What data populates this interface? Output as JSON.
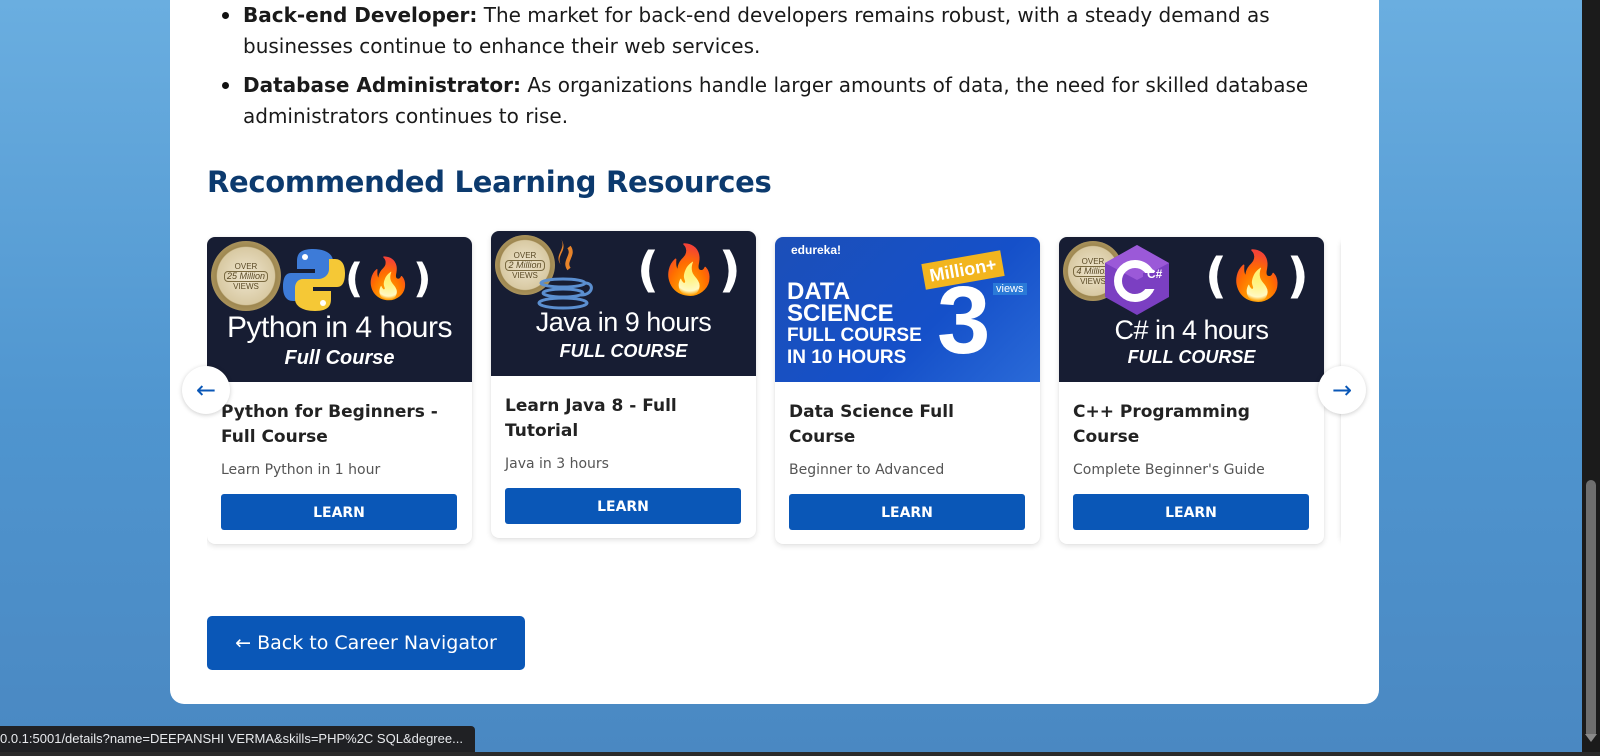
{
  "bullets": [
    {
      "title": "Back-end Developer:",
      "text": " The market for back-end developers remains robust, with a steady demand as businesses continue to enhance their web services."
    },
    {
      "title": "Database Administrator:",
      "text": " As organizations handle larger amounts of data, the need for skilled database administrators continues to rise."
    }
  ],
  "section_title": "Recommended Learning Resources",
  "carousel": {
    "prev_arrow": "←",
    "next_arrow": "→",
    "cards": [
      {
        "thumb": {
          "badge_top": "OVER",
          "badge_mid": "25 Million",
          "badge_bottom": "VIEWS",
          "flame": "(🔥)",
          "headline": "Python in 4 hours",
          "subline": "Full Course"
        },
        "title": "Python for Beginners - Full Course",
        "subtitle": "Learn Python in 1 hour",
        "button": "LEARN"
      },
      {
        "thumb": {
          "badge_top": "OVER",
          "badge_mid": "2 Million",
          "badge_bottom": "VIEWS",
          "flame": "(🔥)",
          "headline": "Java in 9 hours",
          "subline": "FULL COURSE"
        },
        "title": "Learn Java 8 - Full Tutorial",
        "subtitle": "Java in 3 hours",
        "button": "LEARN"
      },
      {
        "thumb": {
          "brand": "edureka!",
          "views_label": "Million+",
          "views_sub": "views",
          "views_number": "3",
          "lines": [
            "DATA",
            "SCIENCE",
            "FULL COURSE",
            "IN 10 HOURS"
          ]
        },
        "title": "Data Science Full Course",
        "subtitle": "Beginner to Advanced",
        "button": "LEARN"
      },
      {
        "thumb": {
          "badge_top": "OVER",
          "badge_mid": "4 Million",
          "badge_bottom": "VIEWS",
          "flame": "(🔥)",
          "headline": "C# in 4 hours",
          "subline": "FULL COURSE",
          "logo_text": "C#"
        },
        "title": "C++ Programming Course",
        "subtitle": "Complete Beginner's Guide",
        "button": "LEARN"
      }
    ]
  },
  "back_button": "← Back to Career Navigator",
  "status_url": "0.0.1:5001/details?name=DEEPANSHI  VERMA&skills=PHP%2C SQL&degree...",
  "colors": {
    "accent": "#0a57b7",
    "heading": "#0c3a6e",
    "background": "#5a9fd6"
  }
}
